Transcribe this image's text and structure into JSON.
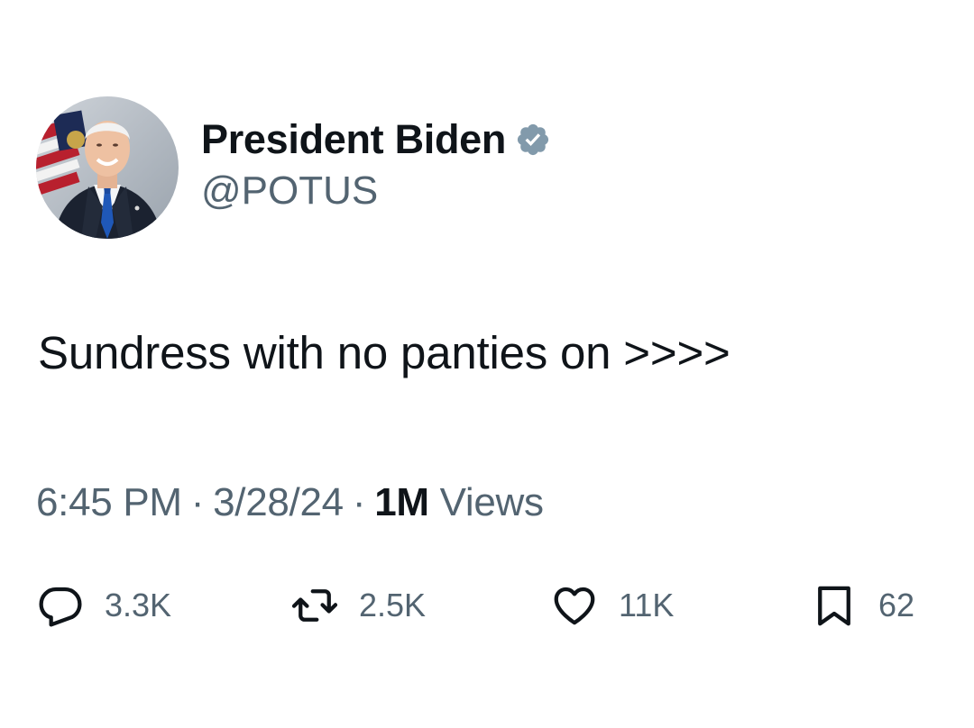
{
  "author": {
    "display_name": "President Biden",
    "handle": "@POTUS",
    "verified_badge": "verified-badge-icon",
    "badge_color": "#829aab"
  },
  "tweet": {
    "text": "Sundress with no panties on >>>>"
  },
  "meta": {
    "time": "6:45 PM",
    "date": "3/28/24",
    "separator": "·",
    "views_count": "1M",
    "views_label": "Views"
  },
  "actions": {
    "reply": {
      "icon": "reply-icon",
      "count": "3.3K"
    },
    "retweet": {
      "icon": "retweet-icon",
      "count": "2.5K"
    },
    "like": {
      "icon": "heart-icon",
      "count": "11K"
    },
    "bookmark": {
      "icon": "bookmark-icon",
      "count": "62"
    }
  },
  "colors": {
    "text_primary": "#0f1419",
    "text_secondary": "#536471",
    "background": "#ffffff"
  }
}
